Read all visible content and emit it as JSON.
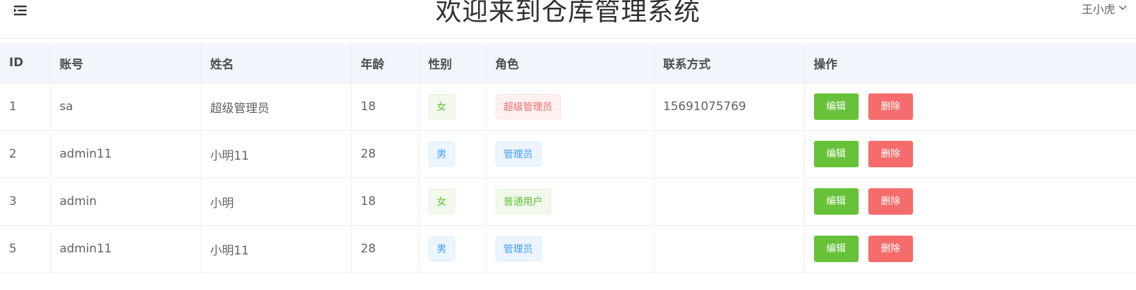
{
  "header": {
    "title": "欢迎来到仓库管理系统",
    "user_name": "王小虎",
    "menu_icon": "menu-fold-icon",
    "dropdown_icon": "chevron-down-icon"
  },
  "table": {
    "columns": [
      "ID",
      "账号",
      "姓名",
      "年龄",
      "性别",
      "角色",
      "联系方式",
      "操作"
    ],
    "rows": [
      {
        "id": "1",
        "account": "sa",
        "name": "超级管理员",
        "age": "18",
        "sex": "女",
        "role": "超级管理员",
        "phone": "15691075769",
        "edit": "编辑",
        "delete": "删除"
      },
      {
        "id": "2",
        "account": "admin11",
        "name": "小明11",
        "age": "28",
        "sex": "男",
        "role": "管理员",
        "phone": "",
        "edit": "编辑",
        "delete": "删除"
      },
      {
        "id": "3",
        "account": "admin",
        "name": "小明",
        "age": "18",
        "sex": "女",
        "role": "普通用户",
        "phone": "",
        "edit": "编辑",
        "delete": "删除"
      },
      {
        "id": "5",
        "account": "admin11",
        "name": "小明11",
        "age": "28",
        "sex": "男",
        "role": "管理员",
        "phone": "",
        "edit": "编辑",
        "delete": "删除"
      }
    ]
  },
  "colors": {
    "header_row_bg": "#f2f5fc",
    "edit_button": "#67c23a",
    "delete_button": "#f56c6c",
    "tag_female": "#67c23a",
    "tag_male": "#409eff",
    "tag_super_admin": "#f56c6c",
    "tag_admin": "#409eff",
    "tag_user": "#67c23a"
  }
}
